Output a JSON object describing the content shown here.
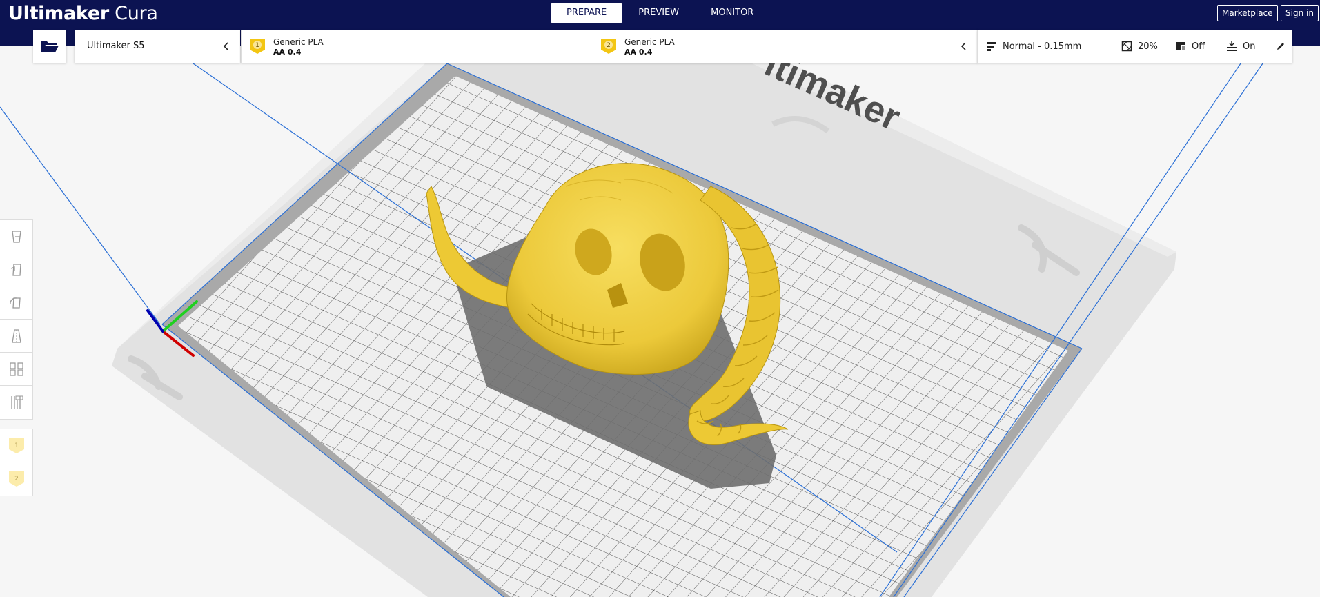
{
  "app": {
    "brand_bold": "Ultimaker",
    "brand_light": "Cura"
  },
  "stages": [
    {
      "label": "PREPARE",
      "active": true
    },
    {
      "label": "PREVIEW",
      "active": false
    },
    {
      "label": "MONITOR",
      "active": false
    }
  ],
  "header": {
    "marketplace_label": "Marketplace",
    "signin_label": "Sign in"
  },
  "printer": {
    "name": "Ultimaker S5"
  },
  "extruders": [
    {
      "number": "1",
      "material": "Generic PLA",
      "nozzle": "AA 0.4",
      "color": "#f3c613"
    },
    {
      "number": "2",
      "material": "Generic PLA",
      "nozzle": "AA 0.4",
      "color": "#f3c613"
    }
  ],
  "print_settings": {
    "profile": "Normal - 0.15mm",
    "infill": "20%",
    "support": "Off",
    "adhesion": "On"
  },
  "viewport": {
    "bed_logo_text": "ltimaker",
    "model_color": "#f0d44e",
    "axis_colors": {
      "x": "#d00000",
      "y": "#1fd01f",
      "z": "#0000b0"
    }
  },
  "side_tools": [
    "move-tool-icon",
    "scale-tool-icon",
    "rotate-tool-icon",
    "mirror-tool-icon",
    "per-model-settings-icon",
    "support-blocker-icon"
  ],
  "side_extruders": [
    "1",
    "2"
  ]
}
